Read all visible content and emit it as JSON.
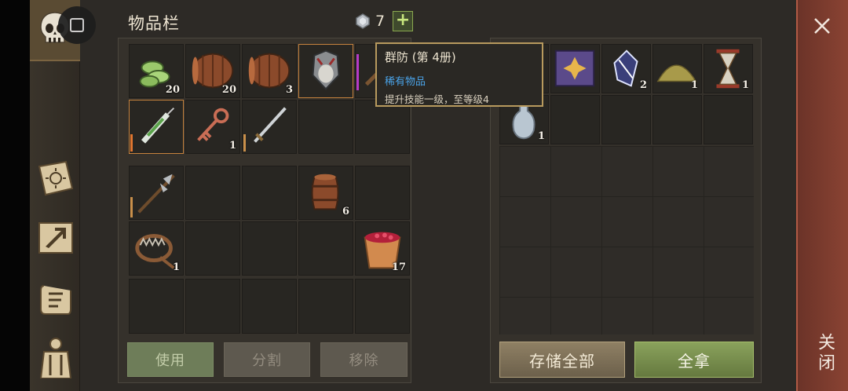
{
  "inventory": {
    "title": "物品栏",
    "currency_count": "7",
    "currency_plus": "+",
    "upper_slots": [
      {
        "icon": "rope-coil-icon",
        "count": "20"
      },
      {
        "icon": "barrel-icon",
        "count": "20"
      },
      {
        "icon": "barrel-icon",
        "count": "3"
      },
      {
        "icon": "skull-helmet-icon",
        "count": ""
      },
      {
        "icon": "pickaxe-icon",
        "count": ""
      },
      {
        "icon": "syringe-icon",
        "count": ""
      },
      {
        "icon": "key-icon",
        "count": "1"
      },
      {
        "icon": "sword-icon",
        "count": ""
      },
      {
        "icon": "",
        "count": ""
      },
      {
        "icon": "",
        "count": ""
      }
    ],
    "lower_slots": [
      {
        "icon": "halberd-icon",
        "count": ""
      },
      {
        "icon": "",
        "count": ""
      },
      {
        "icon": "",
        "count": ""
      },
      {
        "icon": "barrel-icon",
        "count": "6"
      },
      {
        "icon": "",
        "count": ""
      },
      {
        "icon": "bear-trap-icon",
        "count": "1"
      },
      {
        "icon": "",
        "count": ""
      },
      {
        "icon": "",
        "count": ""
      },
      {
        "icon": "",
        "count": ""
      },
      {
        "icon": "berry-bucket-icon",
        "count": "17"
      }
    ],
    "buttons": {
      "use": "使用",
      "split": "分割",
      "remove": "移除"
    }
  },
  "storage": {
    "slots": [
      {
        "icon": "scroll-icon",
        "count": ""
      },
      {
        "icon": "skill-book-icon",
        "count": ""
      },
      {
        "icon": "crystal-icon",
        "count": "2"
      },
      {
        "icon": "sand-pile-icon",
        "count": "1"
      },
      {
        "icon": "hourglass-icon",
        "count": "1"
      },
      {
        "icon": "potion-bottle-icon",
        "count": "1"
      }
    ],
    "buttons": {
      "store_all": "存储全部",
      "take_all": "全拿"
    }
  },
  "tooltip": {
    "title": "群防 (第 4册)",
    "rarity": "稀有物品",
    "description": "提升技能一级，至等级4"
  },
  "close_label": "关闭",
  "colors": {
    "accent_green": "#8aa25c",
    "rare_blue": "#4aa3e8",
    "close_red": "#8a4333"
  }
}
